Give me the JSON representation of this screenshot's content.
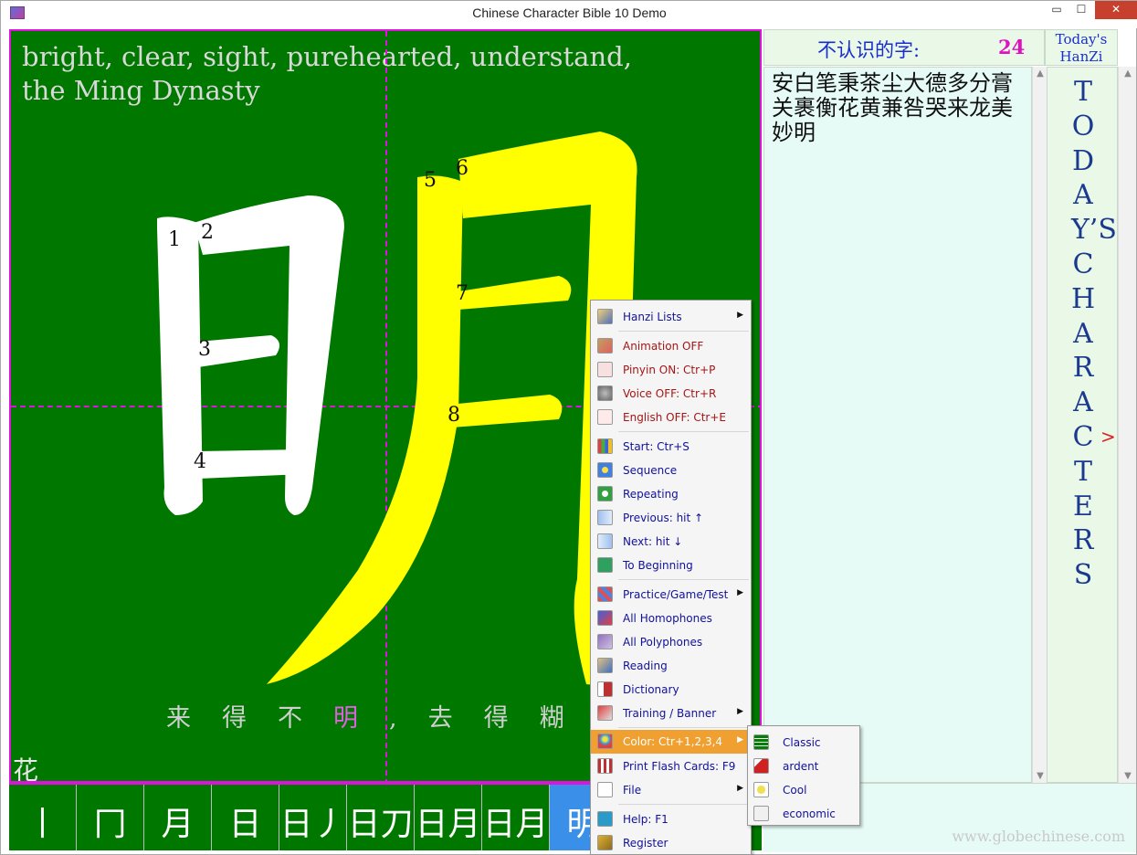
{
  "window": {
    "title": "Chinese Character Bible   10    Demo",
    "min_glyph": "▭",
    "max_glyph": "☐",
    "close_glyph": "✕"
  },
  "canvas": {
    "meaning": "bright, clear, sight, purehearted, understand, the Ming Dynasty",
    "character": "明",
    "stroke_numbers": [
      "1",
      "2",
      "3",
      "4",
      "5",
      "6",
      "7",
      "8"
    ],
    "example_before": "来得不",
    "example_highlight": "明",
    "example_after": ",去得糊涂",
    "corner_char": "花",
    "colors": {
      "background": "#007800",
      "guide": "#e010e0",
      "first_part": "#ffffff",
      "second_part": "#ffff00"
    }
  },
  "sequence": {
    "steps": [
      "丨",
      "冂",
      "月",
      "日",
      "日丿",
      "日刀",
      "日月",
      "日月",
      "明"
    ]
  },
  "sidebar": {
    "unknown_label": "不认识的字:",
    "unknown_count": "24",
    "today_line1": "Today's",
    "today_line2": "HanZi",
    "char_list": "安白笔秉茶尘大德多分膏关裹衡花黄兼咎哭来龙美妙明",
    "vertical_title": "TODAY’S CHARACTERS",
    "arrow": ">",
    "watermark": "www.globechinese.com"
  },
  "context_menu": {
    "items": [
      {
        "label": "Hanzi Lists",
        "icon": "list-icon",
        "submenu": true
      },
      {
        "label": "Animation OFF",
        "icon": "brush-icon",
        "red": true
      },
      {
        "label": "Pinyin ON: Ctr+P",
        "icon": "pinyin-icon",
        "red": true
      },
      {
        "label": "Voice OFF: Ctr+R",
        "icon": "speaker-icon",
        "red": true
      },
      {
        "label": "English OFF: Ctr+E",
        "icon": "letter-a-icon",
        "red": true
      },
      {
        "label": "Start: Ctr+S",
        "icon": "windows-flag-icon"
      },
      {
        "label": "Sequence",
        "icon": "flower-icon"
      },
      {
        "label": "Repeating",
        "icon": "recycle-icon"
      },
      {
        "label": "Previous: hit ↑",
        "icon": "arrow-left-icon"
      },
      {
        "label": "Next: hit ↓",
        "icon": "arrow-right-icon"
      },
      {
        "label": "To Beginning",
        "icon": "reset-icon"
      },
      {
        "label": "Practice/Game/Test",
        "icon": "grid-icon",
        "submenu": true
      },
      {
        "label": "All Homophones",
        "icon": "homophone-icon"
      },
      {
        "label": "All Polyphones",
        "icon": "polyphone-icon"
      },
      {
        "label": "Reading",
        "icon": "reading-icon"
      },
      {
        "label": "Dictionary",
        "icon": "dictionary-icon"
      },
      {
        "label": "Training / Banner",
        "icon": "training-icon",
        "submenu": true
      },
      {
        "label": "Color: Ctr+1,2,3,4",
        "icon": "balloon-icon",
        "submenu": true,
        "highlight": true
      },
      {
        "label": "Print Flash Cards: F9",
        "icon": "flashcard-icon"
      },
      {
        "label": "File",
        "icon": "file-icon",
        "submenu": true
      },
      {
        "label": "Help: F1",
        "icon": "help-icon"
      },
      {
        "label": "Register",
        "icon": "key-icon"
      }
    ]
  },
  "color_submenu": {
    "items": [
      {
        "label": "Classic",
        "icon": "green-grid-icon"
      },
      {
        "label": "ardent",
        "icon": "chili-icon"
      },
      {
        "label": "Cool",
        "icon": "drink-icon"
      },
      {
        "label": "economic",
        "icon": "paper-icon"
      }
    ]
  }
}
